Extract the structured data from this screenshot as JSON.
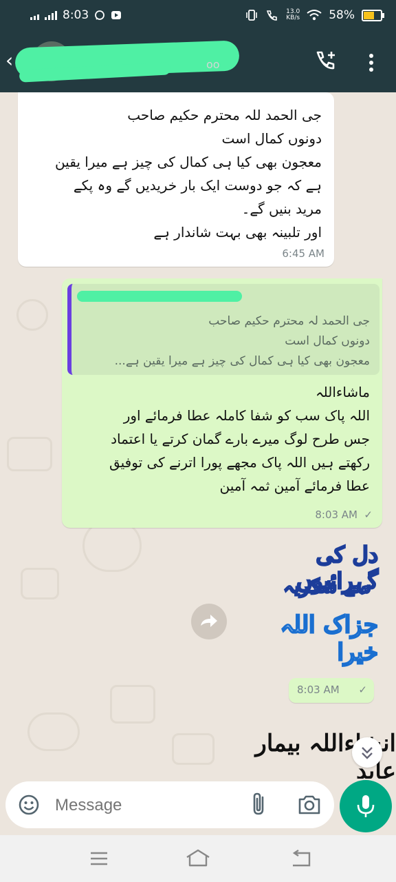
{
  "status_bar": {
    "time": "8:03",
    "speed_value": "13.0",
    "speed_unit": "KB/s",
    "battery": "58%"
  },
  "header": {
    "name_tail": "oo"
  },
  "messages": [
    {
      "direction": "incoming",
      "lines": [
        "جی الحمد للہ محترم حکیم صاحب",
        "دونوں کمال است",
        "معجون بھی کیا ہی کمال کی چیز ہے میرا یقین",
        "ہے کہ جو دوست ایک بار خریدیں گے وہ پکے",
        "مرید بنیں گے۔",
        "اور تلبینہ بھی بہت شاندار ہے"
      ],
      "time": "6:45 AM"
    },
    {
      "direction": "outgoing",
      "quoted_lines": [
        "جی الحمد لہ محترم حکیم صاحب",
        "دونوں کمال است",
        "معجون بھی کیا ہی کمال کی چیز ہے میرا یقین ہے..."
      ],
      "lines": [
        "ماشاءاللہ",
        "اللہ پاک سب کو شفا کاملہ عطا فرمائے اور",
        "جس طرح لوگ میرے بارے گمان کرتے یا اعتماد",
        "رکھتے ہیں اللہ پاک مجھے پورا اترنے کی توفیق",
        "عطا فرمائے آمین ثمہ آمین"
      ],
      "time": "8:03 AM",
      "status": "✓"
    },
    {
      "direction": "outgoing",
      "type": "sticker",
      "sticker_lines": [
        "دل کی گہرائیوں",
        "سے شکریہ",
        "جزاک اللہ خیرا"
      ],
      "time": "8:03 AM",
      "status": "✓"
    }
  ],
  "signature_text": "انشاءاللہ بیمار عابد",
  "composer": {
    "placeholder": "Message"
  }
}
